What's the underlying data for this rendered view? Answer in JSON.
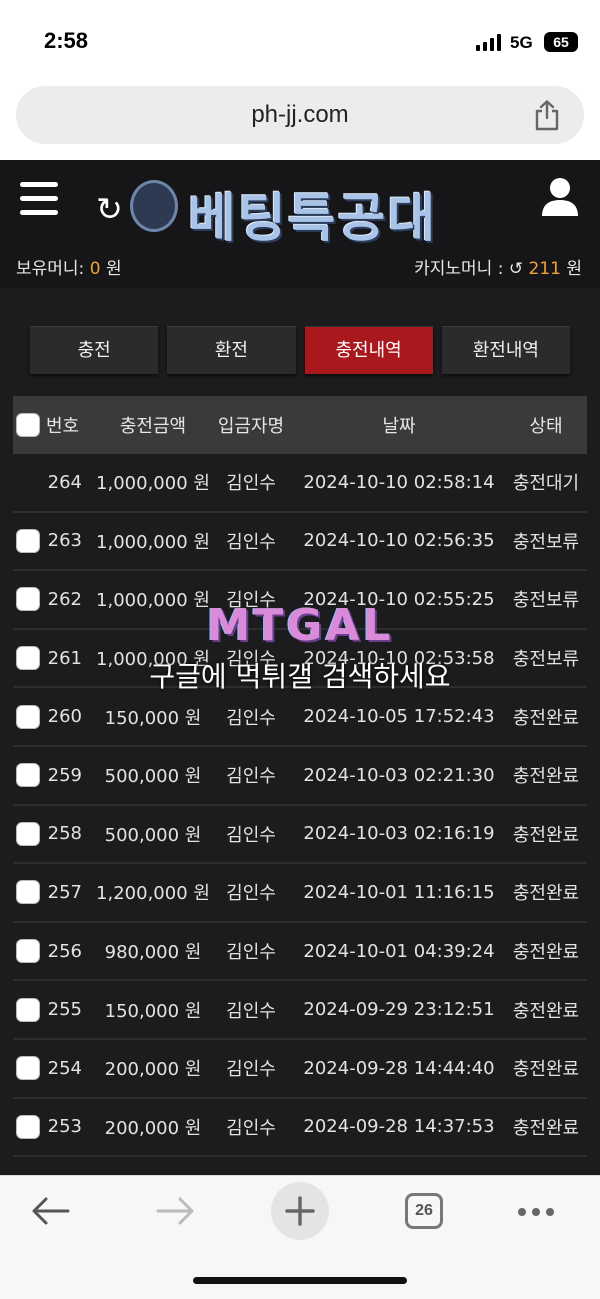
{
  "status_bar": {
    "time": "2:58",
    "network": "5G",
    "battery": "65"
  },
  "browser": {
    "url": "ph-jj.com",
    "tab_count": "26"
  },
  "site": {
    "logo_text": "베팅특공대"
  },
  "wallet": {
    "held_label": "보유머니:",
    "held_value": "0",
    "held_unit": "원",
    "casino_label": "카지노머니 :",
    "casino_value": "211",
    "casino_unit": "원"
  },
  "tabs": [
    {
      "label": "충전",
      "active": false
    },
    {
      "label": "환전",
      "active": false
    },
    {
      "label": "충전내역",
      "active": true
    },
    {
      "label": "환전내역",
      "active": false
    }
  ],
  "table": {
    "headers": {
      "no": "번호",
      "amount": "충전금액",
      "name": "입금자명",
      "date": "날짜",
      "status": "상태"
    },
    "rows": [
      {
        "no": "264",
        "amount": "1,000,000 원",
        "name": "김인수",
        "date": "2024-10-10 02:58:14",
        "status": "충전대기",
        "checkbox": false
      },
      {
        "no": "263",
        "amount": "1,000,000 원",
        "name": "김인수",
        "date": "2024-10-10 02:56:35",
        "status": "충전보류",
        "checkbox": true
      },
      {
        "no": "262",
        "amount": "1,000,000 원",
        "name": "김인수",
        "date": "2024-10-10 02:55:25",
        "status": "충전보류",
        "checkbox": true
      },
      {
        "no": "261",
        "amount": "1,000,000 원",
        "name": "김인수",
        "date": "2024-10-10 02:53:58",
        "status": "충전보류",
        "checkbox": true
      },
      {
        "no": "260",
        "amount": "150,000 원",
        "name": "김인수",
        "date": "2024-10-05 17:52:43",
        "status": "충전완료",
        "checkbox": true
      },
      {
        "no": "259",
        "amount": "500,000 원",
        "name": "김인수",
        "date": "2024-10-03 02:21:30",
        "status": "충전완료",
        "checkbox": true
      },
      {
        "no": "258",
        "amount": "500,000 원",
        "name": "김인수",
        "date": "2024-10-03 02:16:19",
        "status": "충전완료",
        "checkbox": true
      },
      {
        "no": "257",
        "amount": "1,200,000 원",
        "name": "김인수",
        "date": "2024-10-01 11:16:15",
        "status": "충전완료",
        "checkbox": true
      },
      {
        "no": "256",
        "amount": "980,000 원",
        "name": "김인수",
        "date": "2024-10-01 04:39:24",
        "status": "충전완료",
        "checkbox": true
      },
      {
        "no": "255",
        "amount": "150,000 원",
        "name": "김인수",
        "date": "2024-09-29 23:12:51",
        "status": "충전완료",
        "checkbox": true
      },
      {
        "no": "254",
        "amount": "200,000 원",
        "name": "김인수",
        "date": "2024-09-28 14:44:40",
        "status": "충전완료",
        "checkbox": true
      },
      {
        "no": "253",
        "amount": "200,000 원",
        "name": "김인수",
        "date": "2024-09-28 14:37:53",
        "status": "충전완료",
        "checkbox": true
      }
    ]
  },
  "watermark": {
    "logo": "MTGAL",
    "text": "구글에 먹튀갤 검색하세요"
  },
  "colors": {
    "accent_red": "#a8181c",
    "money_orange": "#f0a23a",
    "page_bg": "#1c1c1e"
  },
  "icons": [
    "menu-icon",
    "refresh-icon",
    "user-icon",
    "share-icon",
    "back-arrow-icon",
    "forward-arrow-icon",
    "plus-icon",
    "tabs-icon",
    "more-icon"
  ]
}
